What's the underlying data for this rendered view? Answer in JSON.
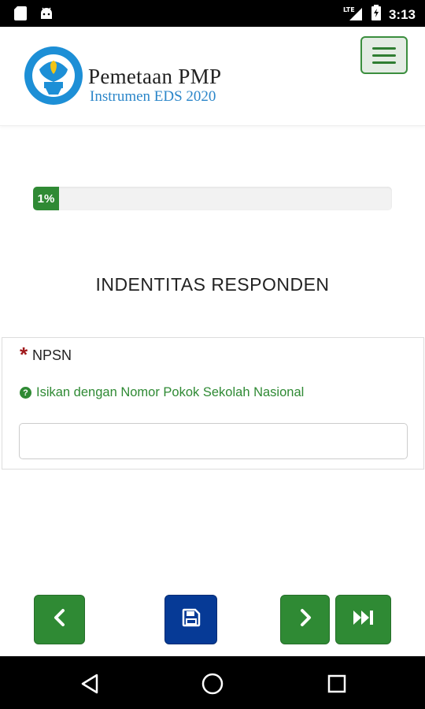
{
  "status_bar": {
    "time": "3:13",
    "network": "LTE",
    "icons": [
      "sd-card-icon",
      "android-icon",
      "signal-icon",
      "battery-charging-icon"
    ]
  },
  "header": {
    "title": "Pemetaan PMP",
    "subtitle": "Instrumen EDS 2020",
    "menu_icon": "hamburger-icon"
  },
  "progress": {
    "label": "1%",
    "value_percent": 1
  },
  "section": {
    "title": "INDENTITAS RESPONDEN"
  },
  "field": {
    "required_mark": "*",
    "label": "NPSN",
    "hint": "Isikan dengan Nomor Pokok Sekolah Nasional",
    "hint_icon": "question-circle-icon",
    "value": "",
    "placeholder": ""
  },
  "nav_buttons": {
    "prev_icon": "chevron-left-icon",
    "save_icon": "save-icon",
    "next_icon": "chevron-right-icon",
    "last_icon": "fast-forward-icon"
  },
  "android_nav": {
    "icons": [
      "back-icon",
      "home-icon",
      "recents-icon"
    ]
  },
  "colors": {
    "primary_green": "#2f8a34",
    "save_blue": "#063a96",
    "required_red": "#a0191c",
    "subtitle_blue": "#2b86c9"
  }
}
